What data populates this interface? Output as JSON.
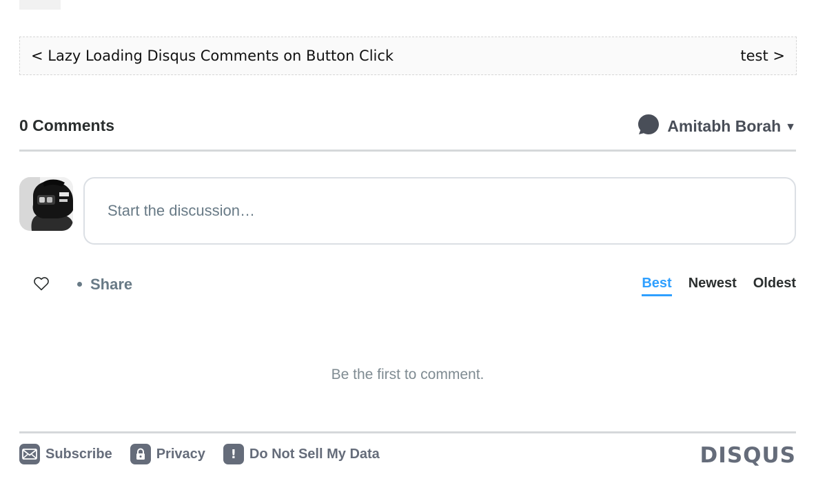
{
  "post_nav": {
    "prev_label": "< Lazy Loading Disqus Comments on Button Click",
    "next_label": "test >"
  },
  "disqus": {
    "comment_count": "0 Comments",
    "user_name": "Amitabh Borah",
    "user_caret": "▼",
    "compose_placeholder": "Start the discussion…",
    "share_label": "Share",
    "sort_tabs": [
      {
        "label": "Best",
        "active": true
      },
      {
        "label": "Newest",
        "active": false
      },
      {
        "label": "Oldest",
        "active": false
      }
    ],
    "empty_message": "Be the first to comment.",
    "footer": {
      "subscribe_label": "Subscribe",
      "privacy_label": "Privacy",
      "do_not_sell_label": "Do Not Sell My Data",
      "do_not_sell_badge": "!",
      "brand": "DISQUS"
    }
  },
  "colors": {
    "accent": "#2e9fff",
    "muted": "#687a86",
    "footer_gray": "#656c7a",
    "divider": "#d5d8da"
  },
  "icons": {
    "user_menu": "chat-bubble-icon",
    "recommend": "heart-icon",
    "subscribe": "envelope-icon",
    "privacy": "lock-icon",
    "do_not_sell": "exclamation-icon"
  }
}
